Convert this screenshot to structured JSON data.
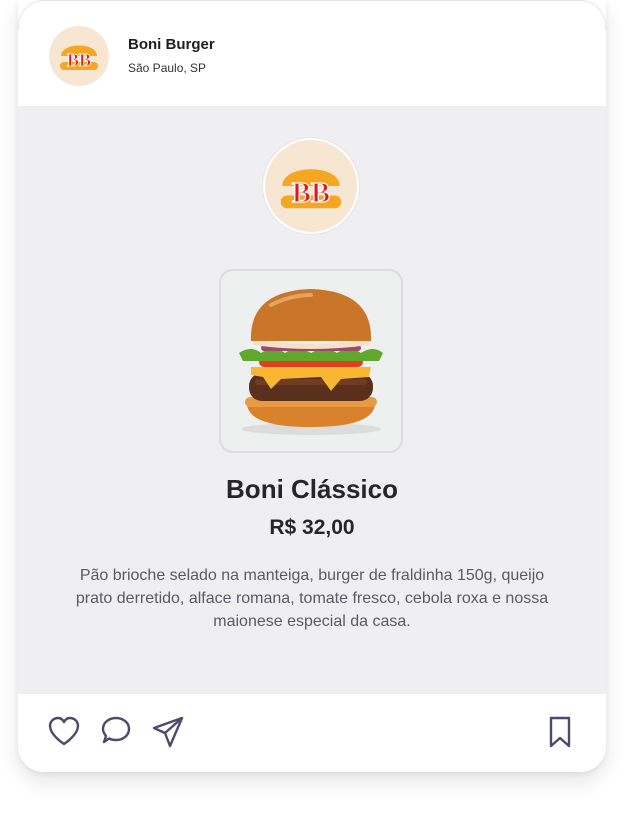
{
  "header": {
    "brand_name": "Boni Burger",
    "location": "São Paulo, SP",
    "logo_text": "BB"
  },
  "product": {
    "name": "Boni Clássico",
    "price": "R$ 32,00",
    "description": "Pão brioche selado na manteiga, burger de fraldinha 150g, queijo prato derretido, alface romana, tomate fresco, cebola roxa e nossa maionese especial da casa."
  },
  "actions": {
    "like_icon": "heart-icon",
    "comment_icon": "comment-icon",
    "share_icon": "send-icon",
    "save_icon": "bookmark-icon"
  },
  "colors": {
    "logo_bg": "#f7e6d1",
    "bun": "#f5a623",
    "logo_text": "#e8141c",
    "content_bg": "#efeff2"
  }
}
